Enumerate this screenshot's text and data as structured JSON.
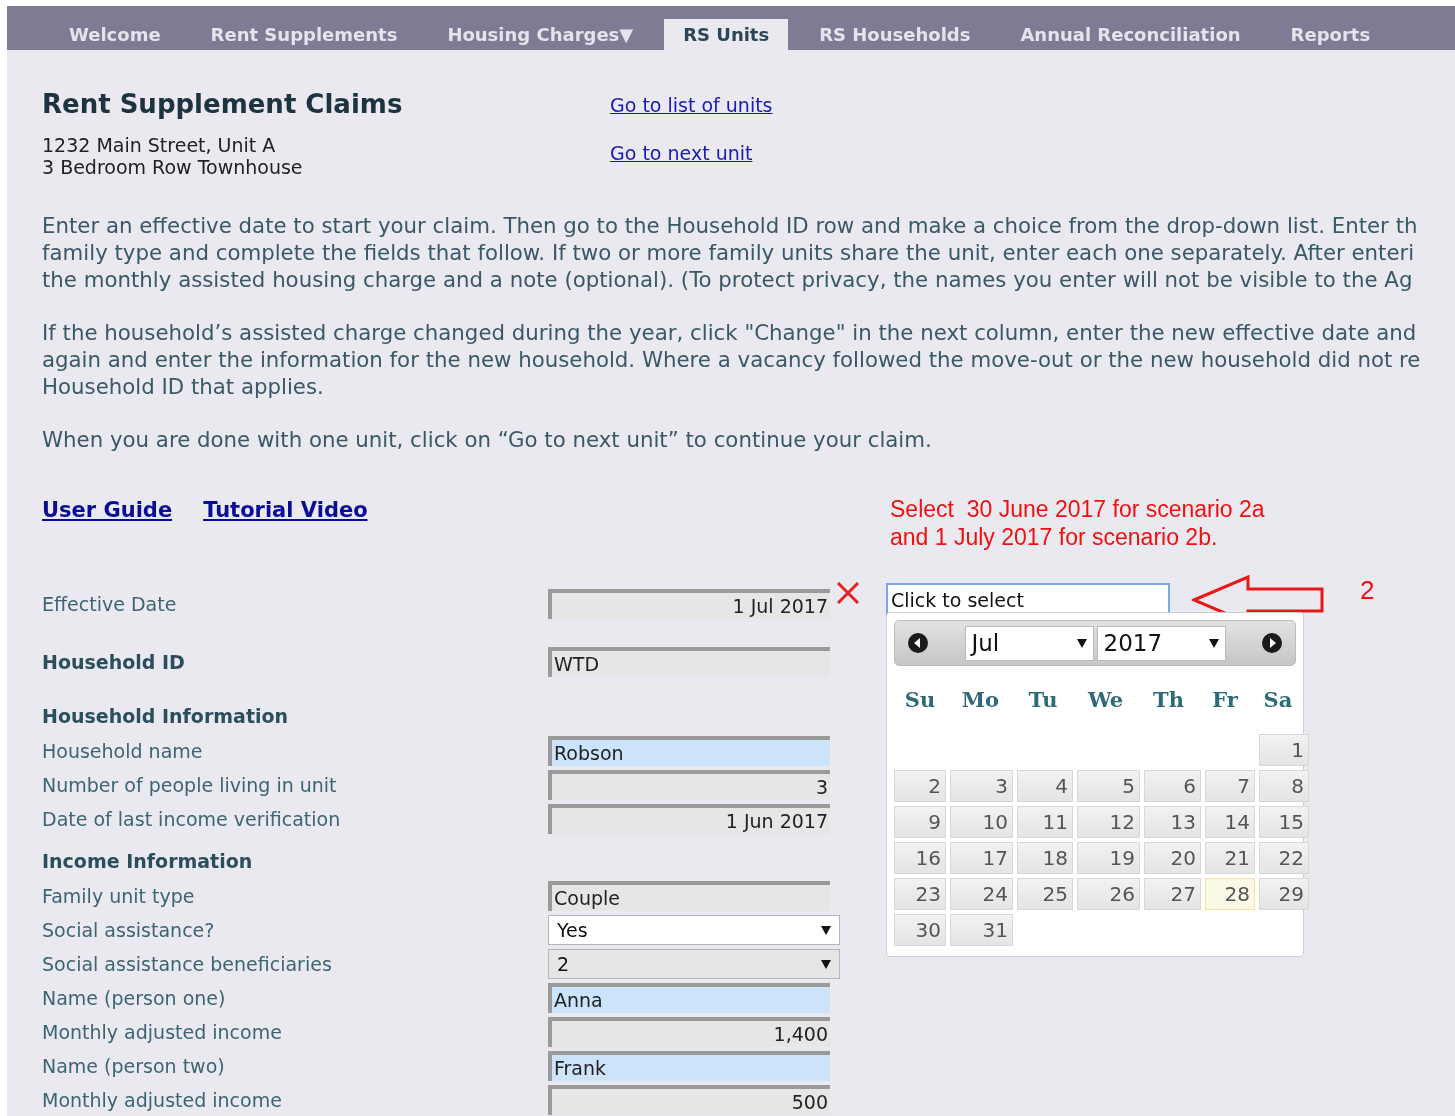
{
  "tabs": [
    {
      "label": "Welcome",
      "selected": false
    },
    {
      "label": "Rent Supplements",
      "selected": false
    },
    {
      "label": "Housing Charges▼",
      "selected": false
    },
    {
      "label": "RS Units",
      "selected": true
    },
    {
      "label": "RS Households",
      "selected": false
    },
    {
      "label": "Annual Reconciliation",
      "selected": false
    },
    {
      "label": "Reports",
      "selected": false
    }
  ],
  "title": "Rent Supplement Claims",
  "address": [
    "1232 Main Street, Unit A",
    "3 Bedroom Row Townhouse"
  ],
  "nav_links": [
    "Go to list of units",
    "Go to next unit"
  ],
  "instructions": [
    {
      "lines": [
        "Enter an effective date to start your claim. Then go to the Household ID row and make a choice from the drop-down list. Enter th",
        "family type and complete the fields that follow. If two or more family units share the unit, enter each one separately. After enteri",
        "the monthly assisted housing charge and a note (optional). (To protect privacy, the names you enter will not be visible to the Ag"
      ]
    },
    {
      "lines": [
        "If the household’s assisted charge changed during the year, click \"Change\" in the next column, enter the new effective date and",
        "again and enter the information for the new household. Where a vacancy followed the move-out or the new household did not re",
        "Household ID that applies."
      ]
    },
    {
      "lines": [
        "When you are done with one unit, click on “Go to next unit” to continue your claim."
      ]
    }
  ],
  "help_links": [
    "User Guide",
    "Tutorial Video"
  ],
  "form": [
    {
      "kind": "field",
      "label": "Effective Date",
      "strong": false,
      "input": {
        "kind": "date",
        "value": "1 Jul 2017",
        "editable": false,
        "clearable": true
      }
    },
    {
      "kind": "field",
      "label": "Household ID",
      "strong": true,
      "input": {
        "kind": "text",
        "value": "WTD",
        "editable": false,
        "clearable": false
      }
    },
    {
      "kind": "section",
      "label": "Household Information"
    },
    {
      "kind": "field",
      "label": "Household name",
      "strong": false,
      "input": {
        "kind": "text",
        "value": "Robson",
        "editable": true,
        "clearable": false
      }
    },
    {
      "kind": "field",
      "label": "Number of people living in unit",
      "strong": false,
      "input": {
        "kind": "number",
        "value": "3",
        "editable": false,
        "clearable": false
      }
    },
    {
      "kind": "field",
      "label": "Date of last income verification",
      "strong": false,
      "input": {
        "kind": "date",
        "value": "1 Jun 2017",
        "editable": false,
        "clearable": false
      }
    },
    {
      "kind": "section",
      "label": "Income Information"
    },
    {
      "kind": "field",
      "label": "Family unit type",
      "strong": false,
      "input": {
        "kind": "text",
        "value": "Couple",
        "editable": false,
        "clearable": false
      }
    },
    {
      "kind": "field",
      "label": "Social assistance?",
      "strong": false,
      "input": {
        "kind": "select",
        "value": "Yes",
        "editable": true,
        "clearable": false
      }
    },
    {
      "kind": "field",
      "label": "Social assistance beneficiaries",
      "strong": false,
      "input": {
        "kind": "select",
        "value": "2",
        "editable": false,
        "clearable": false
      }
    },
    {
      "kind": "field",
      "label": "Name (person one)",
      "strong": false,
      "input": {
        "kind": "text",
        "value": "Anna",
        "editable": true,
        "clearable": false
      }
    },
    {
      "kind": "field",
      "label": "Monthly adjusted income",
      "strong": false,
      "input": {
        "kind": "number",
        "value": "1,400",
        "editable": false,
        "clearable": false
      }
    },
    {
      "kind": "field",
      "label": "Name (person two)",
      "strong": false,
      "input": {
        "kind": "text",
        "value": "Frank",
        "editable": true,
        "clearable": false
      }
    },
    {
      "kind": "field",
      "label": "Monthly adjusted income",
      "strong": false,
      "input": {
        "kind": "number",
        "value": "500",
        "editable": false,
        "clearable": false
      }
    }
  ],
  "annotation": {
    "note": [
      "Select  30 June 2017 for scenario 2a",
      "and 1 July 2017 for scenario 2b."
    ],
    "marker": "2"
  },
  "date_picker": {
    "placeholder": "Click to select",
    "month": "Jul",
    "year": "2017",
    "weekdays": [
      "Su",
      "Mo",
      "Tu",
      "We",
      "Th",
      "Fr",
      "Sa"
    ],
    "weeks": [
      [
        {
          "kind": "empty"
        },
        {
          "kind": "empty"
        },
        {
          "kind": "empty"
        },
        {
          "kind": "empty"
        },
        {
          "kind": "empty"
        },
        {
          "kind": "empty"
        },
        {
          "day": "1",
          "today": false
        }
      ],
      [
        {
          "day": "2",
          "today": false
        },
        {
          "day": "3",
          "today": false
        },
        {
          "day": "4",
          "today": false
        },
        {
          "day": "5",
          "today": false
        },
        {
          "day": "6",
          "today": false
        },
        {
          "day": "7",
          "today": false
        },
        {
          "day": "8",
          "today": false
        }
      ],
      [
        {
          "day": "9",
          "today": false
        },
        {
          "day": "10",
          "today": false
        },
        {
          "day": "11",
          "today": false
        },
        {
          "day": "12",
          "today": false
        },
        {
          "day": "13",
          "today": false
        },
        {
          "day": "14",
          "today": false
        },
        {
          "day": "15",
          "today": false
        }
      ],
      [
        {
          "day": "16",
          "today": false
        },
        {
          "day": "17",
          "today": false
        },
        {
          "day": "18",
          "today": false
        },
        {
          "day": "19",
          "today": false
        },
        {
          "day": "20",
          "today": false
        },
        {
          "day": "21",
          "today": false
        },
        {
          "day": "22",
          "today": false
        }
      ],
      [
        {
          "day": "23",
          "today": false
        },
        {
          "day": "24",
          "today": false
        },
        {
          "day": "25",
          "today": false
        },
        {
          "day": "26",
          "today": false
        },
        {
          "day": "27",
          "today": false
        },
        {
          "day": "28",
          "today": true
        },
        {
          "day": "29",
          "today": false
        }
      ],
      [
        {
          "day": "30",
          "today": false
        },
        {
          "day": "31",
          "today": false
        }
      ]
    ]
  }
}
